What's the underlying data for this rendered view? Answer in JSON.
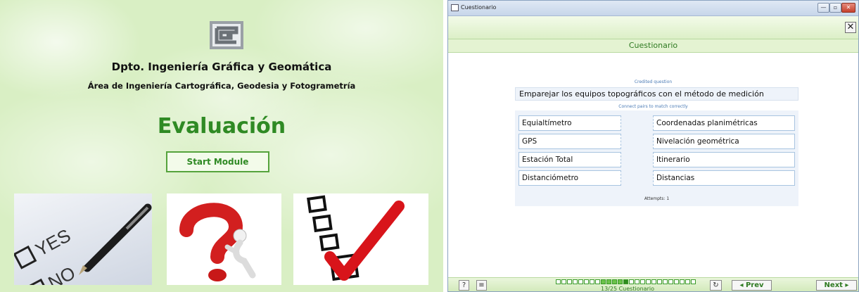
{
  "left": {
    "dept_title": "Dpto. Ingeniería Gráfica y Geomática",
    "dept_subtitle": "Área de Ingeniería Cartográfica, Geodesia y Fotogrametría",
    "heading": "Evaluación",
    "start_button": "Start Module",
    "images": {
      "yes_no_words": [
        "YES",
        "NO"
      ],
      "pic2": "question-mark-figure",
      "pic3": "checkbox-checkmark"
    }
  },
  "window": {
    "title": "Cuestionario",
    "controls": {
      "min": "—",
      "max": "▫",
      "close": "✕"
    },
    "close_x": "✕",
    "header": "Cuestionario"
  },
  "question": {
    "caption": "Credited question",
    "text": "Emparejar los equipos topográficos con el método de medición",
    "instruction": "Connect pairs to match correctly",
    "left_items": [
      "Equialtímetro",
      "GPS",
      "Estación Total",
      "Distanciómetro"
    ],
    "right_items": [
      "Coordenadas planimétricas",
      "Nivelación geométrica",
      "Itinerario",
      "Distancias"
    ],
    "attempts": "Attempts: 1"
  },
  "footer": {
    "help": "?",
    "menu": "≡",
    "refresh": "↻",
    "prev": "◂ Prev",
    "next": "Next ▸",
    "progress_text": "13/25 Cuestionario",
    "progress_current": 13,
    "progress_total": 25
  },
  "colors": {
    "accent": "#2f8a24",
    "panel_bg": "#d9efc4",
    "question_bg": "#eef3fa"
  }
}
